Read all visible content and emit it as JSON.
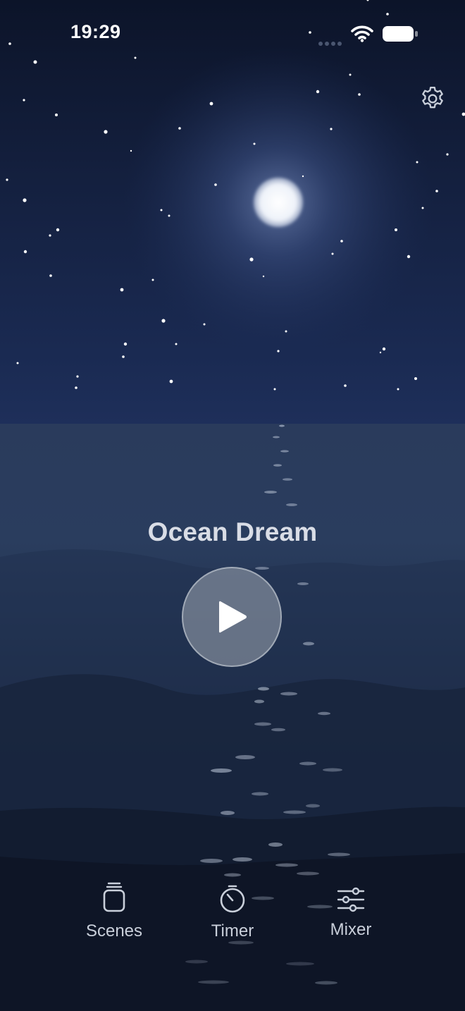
{
  "status_bar": {
    "time": "19:29"
  },
  "scene": {
    "title": "Ocean Dream"
  },
  "tabs": [
    {
      "label": "Scenes",
      "icon": "jar-icon"
    },
    {
      "label": "Timer",
      "icon": "timer-icon"
    },
    {
      "label": "Mixer",
      "icon": "sliders-icon"
    }
  ],
  "colors": {
    "sky_top": "#0c1429",
    "sky_horizon": "#1e2f5a",
    "sea": "#1a2a47",
    "moon": "#e8edf6",
    "play_button": "#8a9099"
  }
}
